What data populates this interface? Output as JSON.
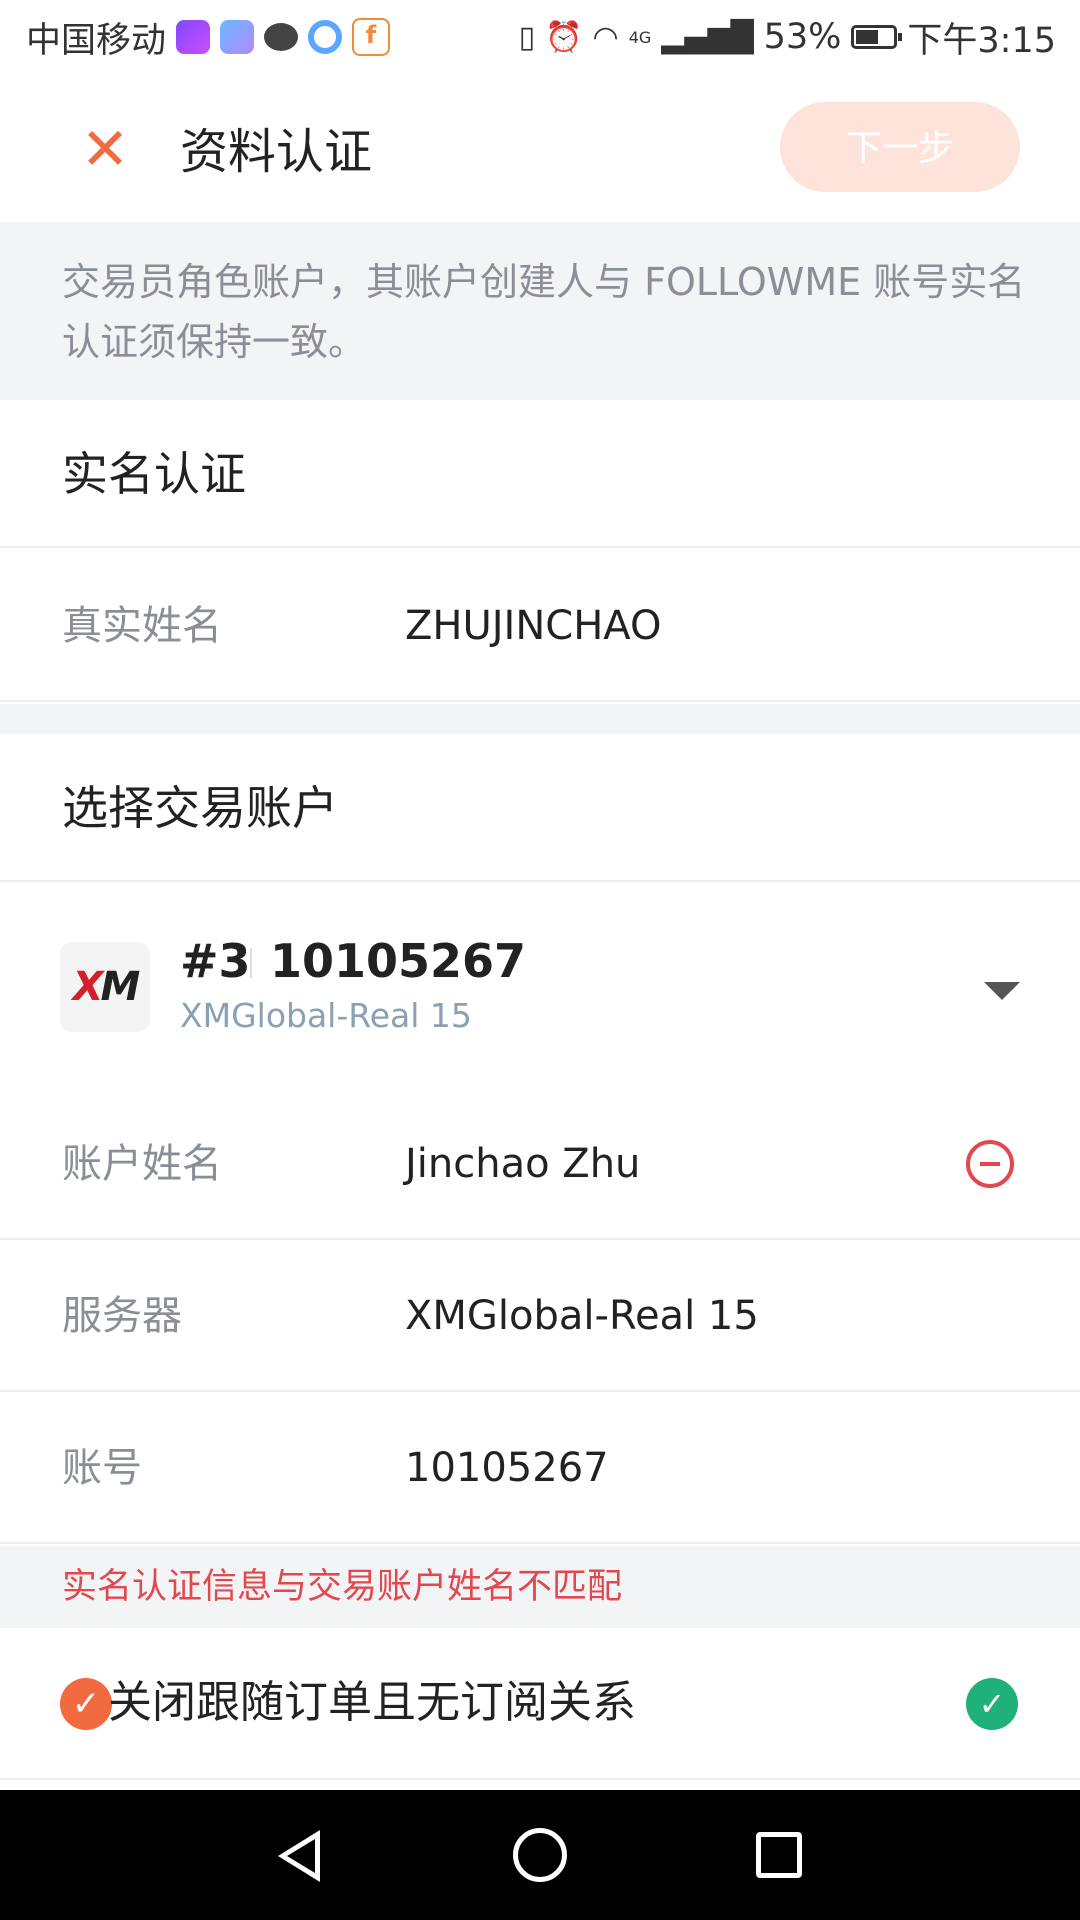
{
  "status_bar": {
    "carrier": "中国移动",
    "network": "4G",
    "battery": "53%",
    "battery_level": 0.53,
    "time": "下午3:15",
    "app_icons": [
      "video-app-icon",
      "chart-app-icon",
      "chat-app-icon",
      "browser-app-icon",
      "followme-app-icon"
    ]
  },
  "header": {
    "title": "资料认证",
    "next_label": "下一步",
    "close_icon": "close-icon"
  },
  "notice": {
    "text": "交易员角色账户，其账户创建人与 FOLLOWME 账号实名认证须保持一致。"
  },
  "real_name_section": {
    "title": "实名认证",
    "name_label": "真实姓名",
    "name_value": "ZHUJINCHAO"
  },
  "account_section": {
    "title": "选择交易账户",
    "selected": {
      "broker_logo": "XM",
      "index": "#3",
      "number": "10105267",
      "server": "XMGlobal-Real 15"
    },
    "fields": [
      {
        "label": "账户姓名",
        "value": "Jinchao Zhu"
      },
      {
        "label": "服务器",
        "value": "XMGlobal-Real 15"
      },
      {
        "label": "账号",
        "value": "10105267"
      }
    ]
  },
  "error": {
    "text": "实名认证信息与交易账户姓名不匹配"
  },
  "option": {
    "label": "关闭跟随订单且无订阅关系"
  },
  "colors": {
    "accent": "#f26a3f",
    "error": "#e2484e",
    "success": "#20b07a",
    "next_disabled_bg": "#fde3da"
  }
}
